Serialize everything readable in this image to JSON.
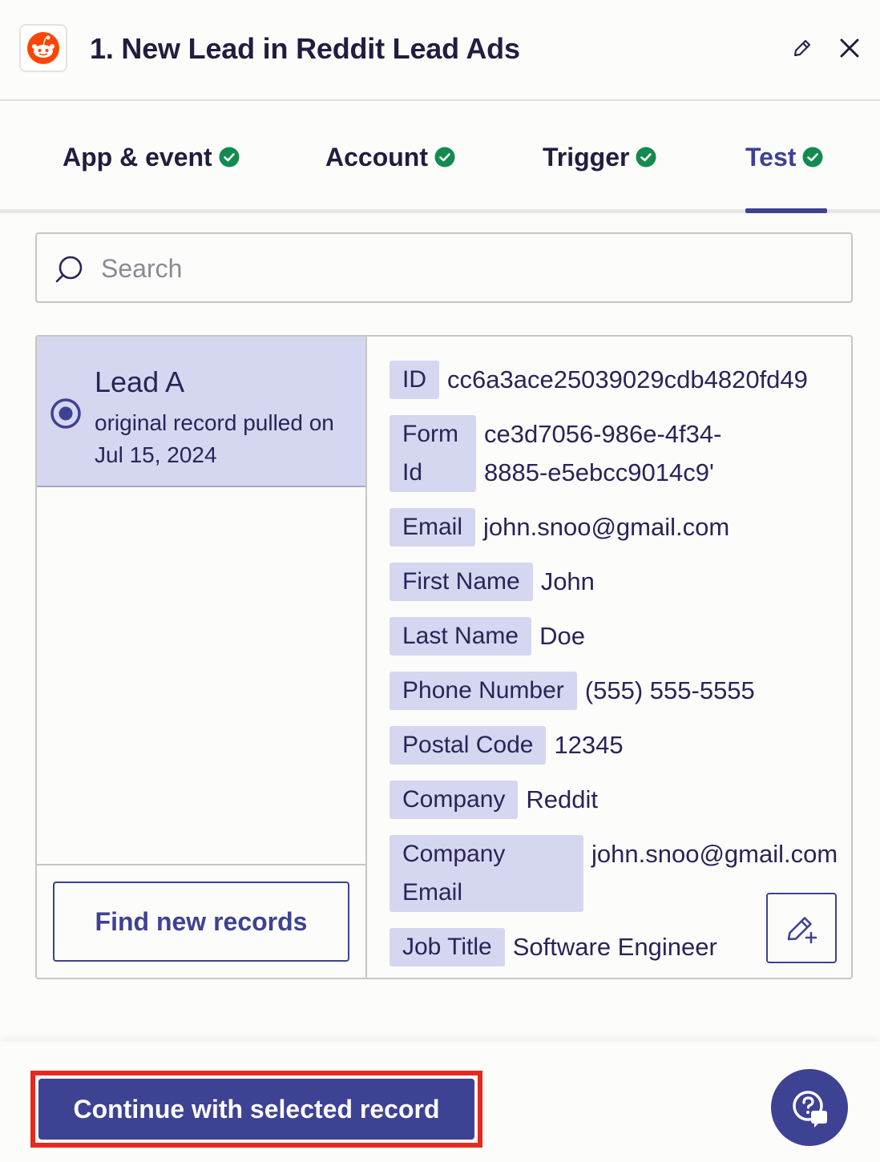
{
  "header": {
    "title": "1. New Lead in Reddit Lead Ads",
    "app_icon": "reddit-logo",
    "edit_icon": "pencil-icon",
    "close_icon": "close-icon"
  },
  "tabs": [
    {
      "label": "App & event",
      "status": "complete"
    },
    {
      "label": "Account",
      "status": "complete"
    },
    {
      "label": "Trigger",
      "status": "complete"
    },
    {
      "label": "Test",
      "status": "complete",
      "active": true
    }
  ],
  "search": {
    "placeholder": "Search",
    "value": ""
  },
  "records": [
    {
      "name": "Lead A",
      "subtitle": "original record pulled on Jul 15, 2024",
      "selected": true
    }
  ],
  "find_button_label": "Find new records",
  "fields": [
    {
      "key": "ID",
      "value": "cc6a3ace25039029cdb4820fd49"
    },
    {
      "key": "Form Id",
      "value": "ce3d7056-986e-4f34-8885-e5ebcc9014c9'"
    },
    {
      "key": "Email",
      "value": "john.snoo@gmail.com"
    },
    {
      "key": "First Name",
      "value": "John"
    },
    {
      "key": "Last Name",
      "value": "Doe"
    },
    {
      "key": "Phone Number",
      "value": "(555) 555-5555"
    },
    {
      "key": "Postal Code",
      "value": "12345"
    },
    {
      "key": "Company",
      "value": "Reddit"
    },
    {
      "key": "Company Email",
      "value": "john.snoo@gmail.com"
    },
    {
      "key": "Job Title",
      "value": "Software Engineer"
    }
  ],
  "continue_button_label": "Continue with selected record",
  "colors": {
    "accent": "#3d4293",
    "selected_bg": "#d5d7f1",
    "success": "#138a4f",
    "highlight": "#e8281c",
    "reddit": "#ff4500"
  }
}
